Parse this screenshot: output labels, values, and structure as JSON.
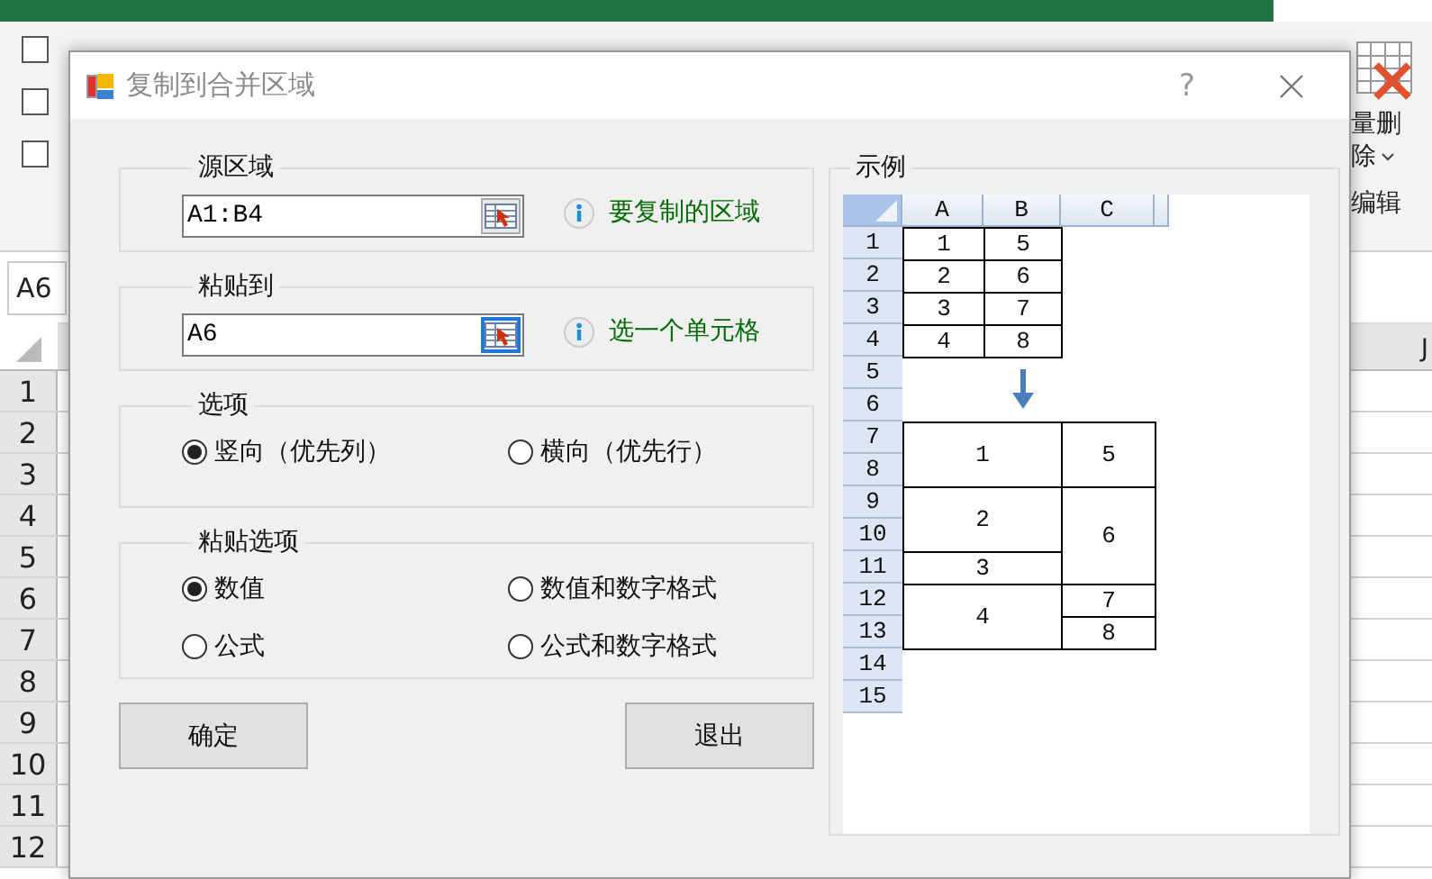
{
  "excel": {
    "checkboxes": [
      {
        "checked": false
      },
      {
        "checked": false
      },
      {
        "checked": false
      }
    ],
    "ribbon_labels": [
      "量删",
      "除",
      "编辑"
    ],
    "name_box": "A6",
    "column_header": "J",
    "row_headers": [
      "1",
      "2",
      "3",
      "4",
      "5",
      "6",
      "7",
      "8",
      "9",
      "10",
      "11",
      "12"
    ]
  },
  "dialog": {
    "title": "复制到合并区域",
    "help": "?",
    "source": {
      "legend": "源区域",
      "value": "A1:B4",
      "hint": "要复制的区域",
      "focused": false
    },
    "target": {
      "legend": "粘贴到",
      "value": "A6",
      "hint": "选一个单元格",
      "focused": true
    },
    "options": {
      "legend": "选项",
      "radios": [
        {
          "label": "竖向（优先列）",
          "selected": true
        },
        {
          "label": "横向（优先行）",
          "selected": false
        }
      ]
    },
    "paste_options": {
      "legend": "粘贴选项",
      "radios": [
        {
          "label": "数值",
          "selected": true
        },
        {
          "label": "数值和数字格式",
          "selected": false
        },
        {
          "label": "公式",
          "selected": false
        },
        {
          "label": "公式和数字格式",
          "selected": false
        }
      ]
    },
    "buttons": [
      "确定",
      "退出"
    ],
    "example": {
      "legend": "示例",
      "columns": [
        "A",
        "B",
        "C"
      ],
      "rows": [
        "1",
        "2",
        "3",
        "4",
        "5",
        "6",
        "7",
        "8",
        "9",
        "10",
        "11",
        "12",
        "13",
        "14",
        "15"
      ],
      "source_cells": [
        "1",
        "5",
        "2",
        "6",
        "3",
        "7",
        "4",
        "8"
      ],
      "result_cells": [
        "1",
        "2",
        "3",
        "4",
        "5",
        "6",
        "7",
        "8"
      ]
    }
  }
}
